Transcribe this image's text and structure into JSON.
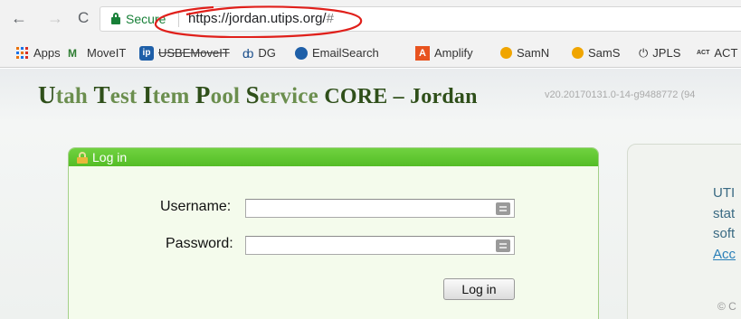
{
  "browser": {
    "back_icon": "←",
    "forward_icon": "→",
    "reload_icon": "C",
    "secure_label": "Secure",
    "url": "https://jordan.utips.org/",
    "url_hash": "#",
    "annotation_color": "#e0201b"
  },
  "bookmarks": [
    {
      "label": "Apps",
      "icon": "apps-grid-icon"
    },
    {
      "label": "MoveIT",
      "icon": "moveit-icon"
    },
    {
      "label": "USBEMoveIT",
      "icon": "ip-icon"
    },
    {
      "label": "DG",
      "icon": "dg-icon"
    },
    {
      "label": "EmailSearch",
      "icon": "email-search-icon"
    },
    {
      "label": "Amplify",
      "icon": "amplify-icon"
    },
    {
      "label": "SamN",
      "icon": "orange-dot-icon"
    },
    {
      "label": "SamS",
      "icon": "orange-dot-icon"
    },
    {
      "label": "JPLS",
      "icon": "power-icon"
    },
    {
      "label": "ACT",
      "icon": "act-icon"
    }
  ],
  "page": {
    "title_caps": [
      "U",
      "T",
      "I",
      "P",
      "S"
    ],
    "title_rest": [
      "tah ",
      "est ",
      "tem ",
      "ool ",
      "ervice "
    ],
    "title_suffix": "CORE – Jordan",
    "version": "v20.20170131.0-14-g9488772 (94",
    "login": {
      "header": "Log in",
      "username_label": "Username:",
      "password_label": "Password:",
      "button": "Log in"
    },
    "info": {
      "line1": "UTI",
      "line2": "stat",
      "line3": "soft",
      "link": "Acc",
      "copyright": "© C"
    }
  },
  "colors": {
    "brand_green": "#54bd26",
    "title_dark": "#2f4f1a",
    "title_light": "#6b8e4e",
    "secure_green": "#188038"
  }
}
